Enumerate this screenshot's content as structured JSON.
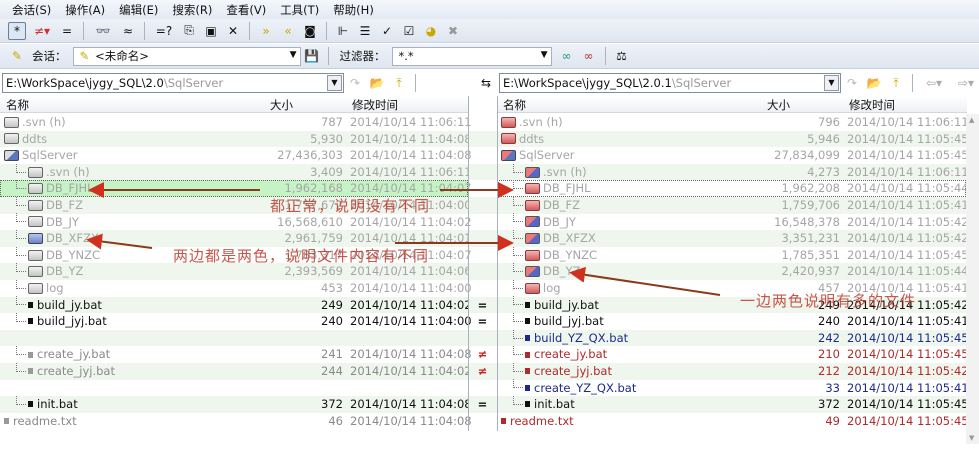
{
  "menu": [
    "会话(S)",
    "操作(A)",
    "编辑(E)",
    "搜索(R)",
    "查看(V)",
    "工具(T)",
    "帮助(H)"
  ],
  "toolbar1": [
    {
      "name": "show-all-icon",
      "glyph": "*",
      "pressed": true
    },
    {
      "name": "show-differences-icon",
      "glyph": "≠▾",
      "color": "#d03030"
    },
    {
      "name": "show-same-icon",
      "glyph": "="
    },
    {
      "sep": true
    },
    {
      "name": "glasses-icon",
      "glyph": "👓"
    },
    {
      "name": "approx-icon",
      "glyph": "≈"
    },
    {
      "sep": true
    },
    {
      "name": "compare-contents-icon",
      "glyph": "=?"
    },
    {
      "name": "copy-to-icon",
      "glyph": "⎘"
    },
    {
      "name": "new-folder-icon",
      "glyph": "▣"
    },
    {
      "name": "delete-icon",
      "glyph": "✕"
    },
    {
      "sep": true
    },
    {
      "name": "copy-right-icon",
      "glyph": "»",
      "color": "#c9a800"
    },
    {
      "name": "copy-left-icon",
      "glyph": "«",
      "color": "#c9a800"
    },
    {
      "name": "snapshot-icon",
      "glyph": "◙"
    },
    {
      "sep": true
    },
    {
      "name": "expand-tree-icon",
      "glyph": "⊩"
    },
    {
      "name": "list-icon",
      "glyph": "☰"
    },
    {
      "name": "check-icon",
      "glyph": "✓"
    },
    {
      "name": "checkbox-icon",
      "glyph": "☑"
    },
    {
      "name": "refresh-icon",
      "glyph": "◕",
      "color": "#c9a800"
    },
    {
      "name": "stop-icon",
      "glyph": "✖",
      "color": "#999"
    }
  ],
  "session": {
    "label": "会话：",
    "value": "<未命名>"
  },
  "filter": {
    "label": "过滤器：",
    "value": "*.*"
  },
  "left": {
    "path_main": "E:\\WorkSpace\\jygy_SQL\\2.0",
    "path_sub": "\\SqlServer",
    "columns": {
      "name": "名称",
      "size": "大小",
      "modified": "修改时间"
    }
  },
  "right": {
    "path_main": "E:\\WorkSpace\\jygy_SQL\\2.0.1",
    "path_sub": "\\SqlServer",
    "columns": {
      "name": "名称",
      "size": "大小",
      "modified": "修改时间"
    }
  },
  "rows": [
    {
      "l": {
        "name": ".svn  (h)",
        "size": "787",
        "date": "2014/10/14 11:06:11",
        "icon": "fold gray",
        "color": "gray",
        "indent": 0
      },
      "r": {
        "name": ".svn  (h)",
        "size": "796",
        "date": "2014/10/14 11:06:11",
        "icon": "fold red",
        "color": "gray",
        "indent": 0
      }
    },
    {
      "l": {
        "name": "ddts",
        "size": "5,930",
        "date": "2014/10/14 11:04:08",
        "icon": "fold gray",
        "color": "gray",
        "indent": 0
      },
      "r": {
        "name": "ddts",
        "size": "5,946",
        "date": "2014/10/14 11:05:45",
        "icon": "fold red",
        "color": "gray",
        "indent": 0
      }
    },
    {
      "l": {
        "name": "SqlServer",
        "size": "27,436,303",
        "date": "2014/10/14 11:04:08",
        "icon": "fold opengray",
        "color": "gray",
        "indent": 0
      },
      "r": {
        "name": "SqlServer",
        "size": "27,834,099",
        "date": "2014/10/14 11:05:45",
        "icon": "fold opentwo",
        "color": "gray",
        "indent": 0
      }
    },
    {
      "l": {
        "name": ".svn  (h)",
        "size": "3,409",
        "date": "2014/10/14 11:06:11",
        "icon": "fold gray",
        "color": "gray",
        "indent": 1
      },
      "r": {
        "name": ".svn  (h)",
        "size": "4,273",
        "date": "2014/10/14 11:06:11",
        "icon": "fold two",
        "color": "gray",
        "indent": 1
      }
    },
    {
      "sel": true,
      "l": {
        "name": "DB_FJHL",
        "size": "1,962,168",
        "date": "2014/10/14 11:04:07",
        "icon": "fold gray",
        "color": "gray",
        "indent": 1
      },
      "r": {
        "name": "DB_FJHL",
        "size": "1,962,208",
        "date": "2014/10/14 11:05:44",
        "icon": "fold red",
        "color": "gray",
        "indent": 1
      }
    },
    {
      "l": {
        "name": "DB_FZ",
        "size": "1,757,672",
        "date": "2014/10/14 11:04:00",
        "icon": "fold gray",
        "color": "gray",
        "indent": 1
      },
      "r": {
        "name": "DB_FZ",
        "size": "1,759,706",
        "date": "2014/10/14 11:05:41",
        "icon": "fold red",
        "color": "gray",
        "indent": 1
      }
    },
    {
      "l": {
        "name": "DB_JY",
        "size": "16,568,610",
        "date": "2014/10/14 11:04:02",
        "icon": "fold gray",
        "color": "gray",
        "indent": 1
      },
      "r": {
        "name": "DB_JY",
        "size": "16,548,378",
        "date": "2014/10/14 11:05:42",
        "icon": "fold two",
        "color": "gray",
        "indent": 1
      }
    },
    {
      "l": {
        "name": "DB_XFZX",
        "size": "2,961,759",
        "date": "2014/10/14 11:04:01",
        "icon": "fold blue",
        "color": "gray",
        "indent": 1
      },
      "r": {
        "name": "DB_XFZX",
        "size": "3,351,231",
        "date": "2014/10/14 11:05:42",
        "icon": "fold two",
        "color": "gray",
        "indent": 1
      }
    },
    {
      "l": {
        "name": "DB_YNZC",
        "size": "1,783,317",
        "date": "2014/10/14 11:04:07",
        "icon": "fold gray",
        "color": "gray",
        "indent": 1
      },
      "r": {
        "name": "DB_YNZC",
        "size": "1,785,351",
        "date": "2014/10/14 11:05:45",
        "icon": "fold red",
        "color": "gray",
        "indent": 1
      }
    },
    {
      "l": {
        "name": "DB_YZ",
        "size": "2,393,569",
        "date": "2014/10/14 11:04:06",
        "icon": "fold gray",
        "color": "gray",
        "indent": 1
      },
      "r": {
        "name": "DB_YZ",
        "size": "2,420,937",
        "date": "2014/10/14 11:05:44",
        "icon": "fold two",
        "color": "gray",
        "indent": 1
      }
    },
    {
      "l": {
        "name": "log",
        "size": "453",
        "date": "2014/10/14 11:04:00",
        "icon": "fold gray",
        "color": "gray",
        "indent": 1
      },
      "r": {
        "name": "log",
        "size": "457",
        "date": "2014/10/14 11:05:41",
        "icon": "fold red",
        "color": "gray",
        "indent": 1
      }
    },
    {
      "gutter": "=",
      "l": {
        "name": "build_jy.bat",
        "size": "249",
        "date": "2014/10/14 11:04:02",
        "icon": "sq black",
        "color": "black",
        "indent": 1
      },
      "r": {
        "name": "build_jy.bat",
        "size": "249",
        "date": "2014/10/14 11:05:42",
        "icon": "sq black",
        "color": "black",
        "indent": 1
      }
    },
    {
      "gutter": "=",
      "l": {
        "name": "build_jyj.bat",
        "size": "240",
        "date": "2014/10/14 11:04:00",
        "icon": "sq black",
        "color": "black",
        "indent": 1
      },
      "r": {
        "name": "build_jyj.bat",
        "size": "240",
        "date": "2014/10/14 11:05:41",
        "icon": "sq black",
        "color": "black",
        "indent": 1
      }
    },
    {
      "r": {
        "name": "build_YZ_QX.bat",
        "size": "242",
        "date": "2014/10/14 11:05:45",
        "icon": "sq navy",
        "color": "navy",
        "indent": 1
      }
    },
    {
      "gutter": "≠",
      "l": {
        "name": "create_jy.bat",
        "size": "241",
        "date": "2014/10/14 11:04:08",
        "icon": "sq gray",
        "color": "dim",
        "indent": 1
      },
      "r": {
        "name": "create_jy.bat",
        "size": "210",
        "date": "2014/10/14 11:05:45",
        "icon": "sq red",
        "color": "red",
        "indent": 1
      }
    },
    {
      "gutter": "≠",
      "l": {
        "name": "create_jyj.bat",
        "size": "244",
        "date": "2014/10/14 11:04:02",
        "icon": "sq gray",
        "color": "dim",
        "indent": 1
      },
      "r": {
        "name": "create_jyj.bat",
        "size": "212",
        "date": "2014/10/14 11:05:42",
        "icon": "sq red",
        "color": "red",
        "indent": 1
      }
    },
    {
      "r": {
        "name": "create_YZ_QX.bat",
        "size": "33",
        "date": "2014/10/14 11:05:41",
        "icon": "sq navy",
        "color": "navy",
        "indent": 1
      }
    },
    {
      "gutter": "=",
      "l": {
        "name": "init.bat",
        "size": "372",
        "date": "2014/10/14 11:04:08",
        "icon": "sq black",
        "color": "black",
        "indent": 1
      },
      "r": {
        "name": "init.bat",
        "size": "372",
        "date": "2014/10/14 11:05:45",
        "icon": "sq black",
        "color": "black",
        "indent": 1
      }
    },
    {
      "l": {
        "name": "readme.txt",
        "size": "46",
        "date": "2014/10/14 11:04:08",
        "icon": "sq gray",
        "color": "dim",
        "indent": 0
      },
      "r": {
        "name": "readme.txt",
        "size": "49",
        "date": "2014/10/14 11:05:45",
        "icon": "sq red",
        "color": "red",
        "indent": 0
      }
    }
  ],
  "annotations": {
    "same": "都正常，说明没有不同",
    "content_diff": "两边都是两色，说明文件内容有不同",
    "extra_files": "一边两色说明有多的文件"
  },
  "colors": {
    "annotation": "#d0301e",
    "selected_row": "#c6f3c6",
    "alt_row": "#eff6ee"
  }
}
